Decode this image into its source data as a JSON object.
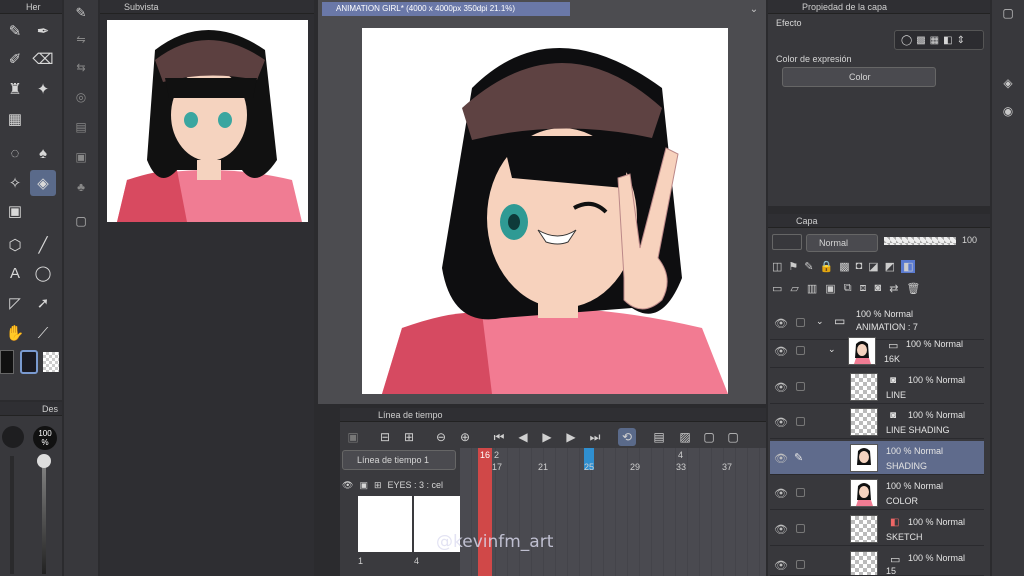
{
  "left_tools": {
    "header_label": "Her",
    "tools": [
      "pen-icon",
      "pen-nib-icon",
      "marker-icon",
      "eraser-icon",
      "fill-icon",
      "sparkle-icon",
      "grid-icon",
      "empty",
      "lasso-icon",
      "droplet-icon",
      "magic-wand-icon",
      "bucket-icon",
      "gradient-icon",
      "empty",
      "transform-icon",
      "line-icon",
      "text-icon",
      "balloon-icon",
      "ruler-icon",
      "move-icon",
      "hand-icon",
      "eyedropper-icon"
    ]
  },
  "brush": {
    "header_label": "Des",
    "size_label": "100",
    "size_unit": "%"
  },
  "subview": {
    "title": "Subvista"
  },
  "canvas": {
    "tab_title": "ANIMATION GIRL* (4000 x 4000px 350dpi 21.1%)"
  },
  "properties": {
    "title": "Propiedad de la capa",
    "effect_label": "Efecto",
    "expression_label": "Color de expresión",
    "expression_value": "Color"
  },
  "layers_panel": {
    "title": "Capa",
    "blend_mode": "Normal",
    "opacity": "100",
    "layers": [
      {
        "name": "ANIMATION : 7",
        "info": "100 % Normal",
        "kind": "folder",
        "selected": false
      },
      {
        "name": "16K",
        "info": "100 % Normal",
        "kind": "folder-thumb",
        "selected": false
      },
      {
        "name": "LINE",
        "info": "100 % Normal",
        "kind": "raster",
        "selected": false
      },
      {
        "name": "LINE SHADING",
        "info": "100 % Normal",
        "kind": "raster",
        "selected": false
      },
      {
        "name": "SHADING",
        "info": "100 % Normal",
        "kind": "thumb",
        "selected": true
      },
      {
        "name": "COLOR",
        "info": "100 % Normal",
        "kind": "thumb",
        "selected": false
      },
      {
        "name": "SKETCH",
        "info": "100 % Normal",
        "kind": "raster",
        "selected": false
      },
      {
        "name": "15",
        "info": "100 % Normal",
        "kind": "raster",
        "selected": false
      }
    ]
  },
  "timeline": {
    "title": "Línea de tiempo",
    "selector": "Línea de tiempo 1",
    "track_name": "EYES : 3 : cel",
    "frame_numbers": [
      "2",
      "17",
      "21",
      "25",
      "29",
      "33",
      "37",
      "4"
    ],
    "current_frame": "16",
    "cel_labels": [
      "1",
      "4"
    ]
  },
  "watermark": "@kevinfm_art",
  "colors": {
    "accent": "#5a6a8a",
    "playhead": "#d04848",
    "marker": "#2f8fd0"
  }
}
